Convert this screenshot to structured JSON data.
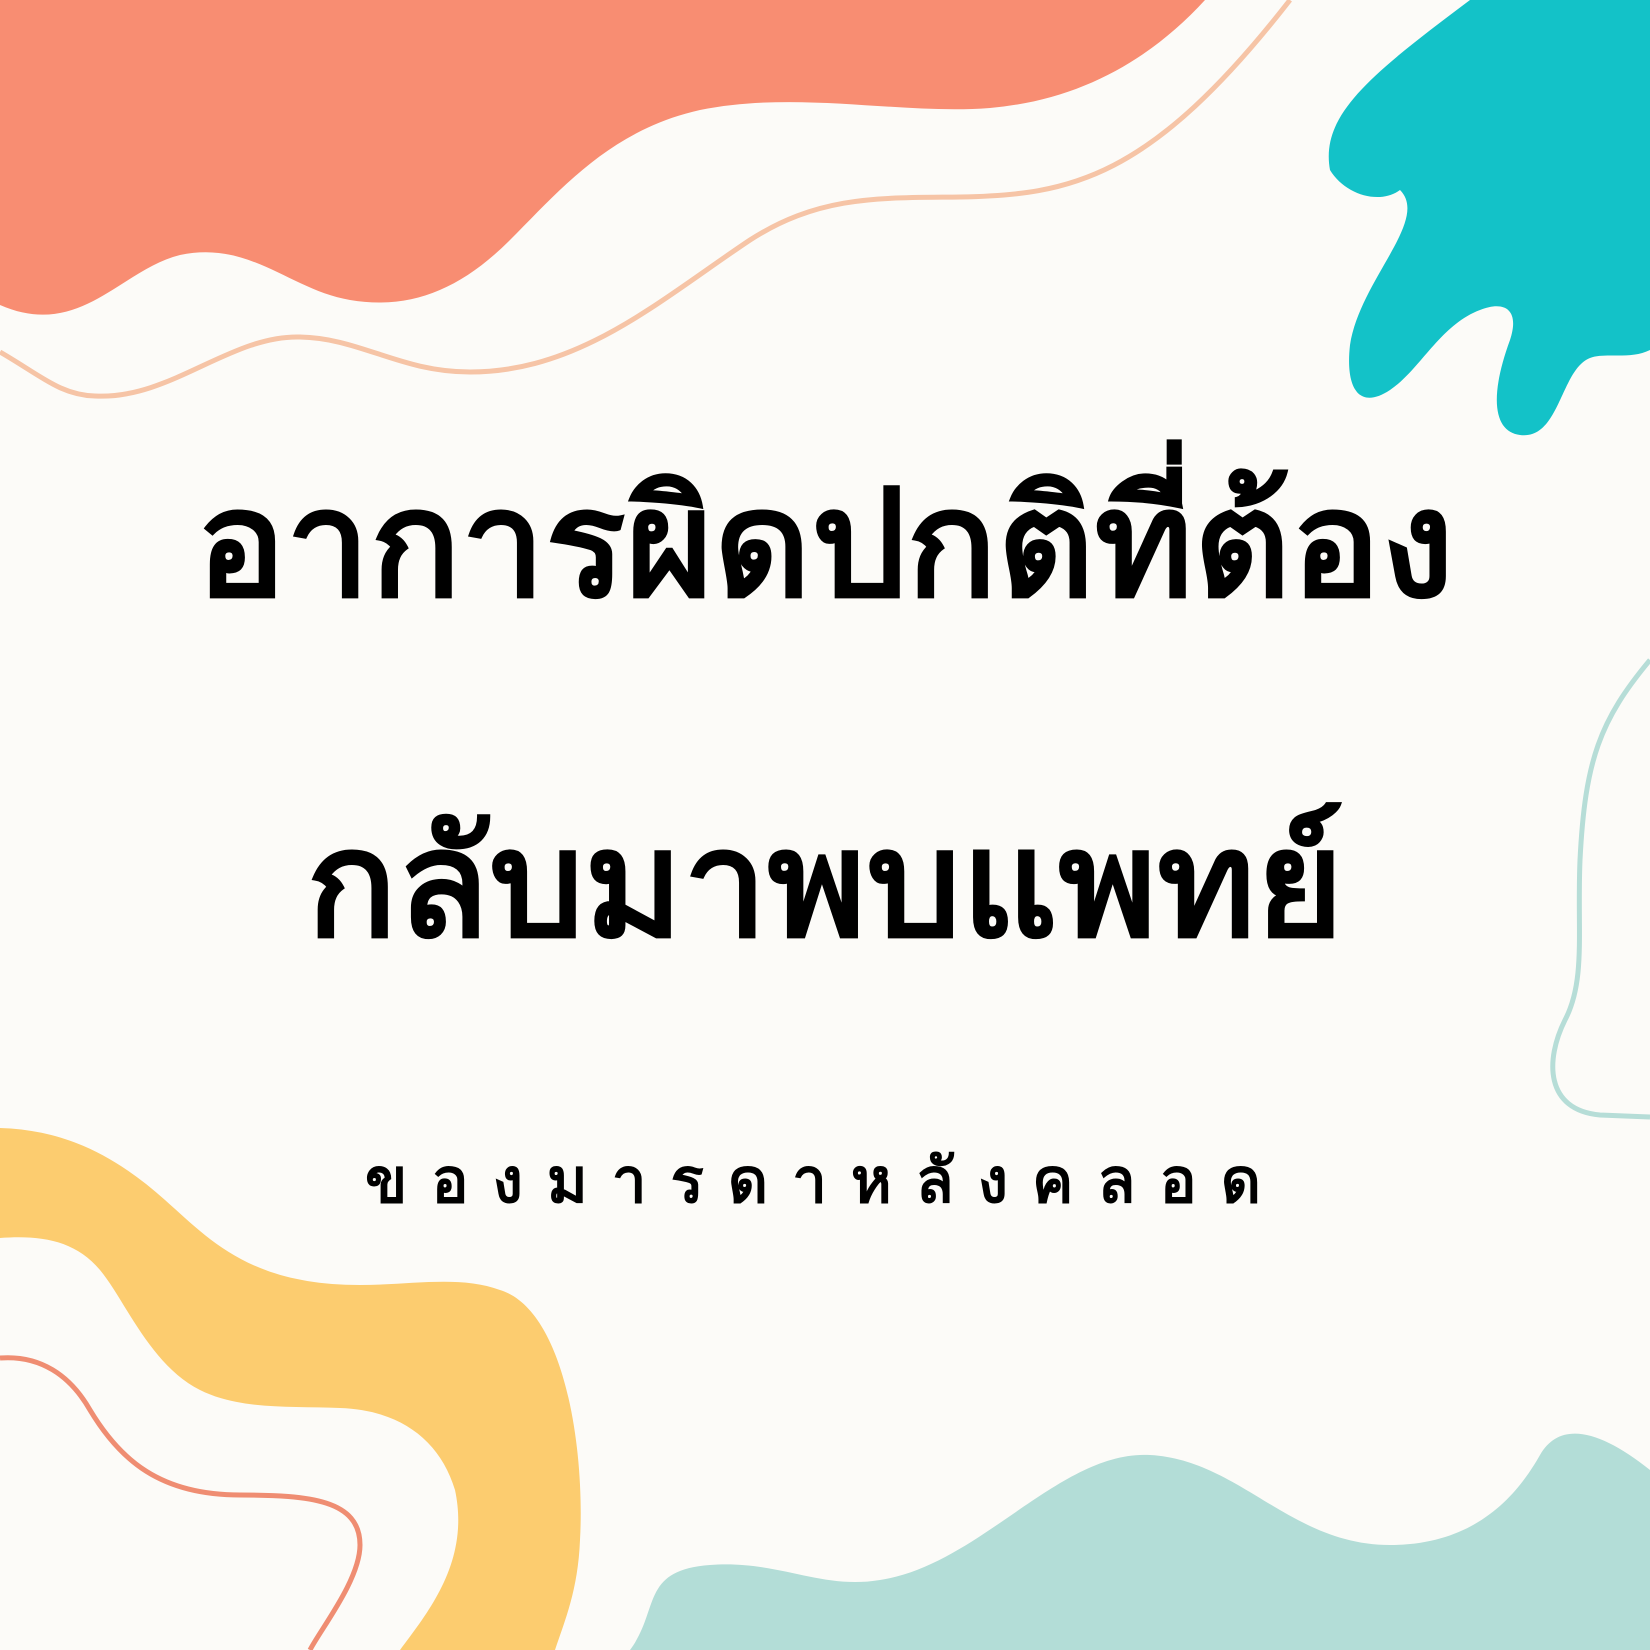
{
  "title": {
    "line1": "อาการผิดปกติที่ต้อง",
    "line2": "กลับมาพบแพทย์"
  },
  "subtitle": "ของมารดาหลังคลอด",
  "colors": {
    "background": "#fcfbf8",
    "coral": "#f88d72",
    "peach_stroke": "#f6c4a6",
    "teal": "#13c2c8",
    "mint": "#b3ddd7",
    "mint_stroke": "#b6ddd7",
    "yellow": "#fccc6f",
    "salmon_stroke": "#ef8d72",
    "text": "#000000"
  }
}
